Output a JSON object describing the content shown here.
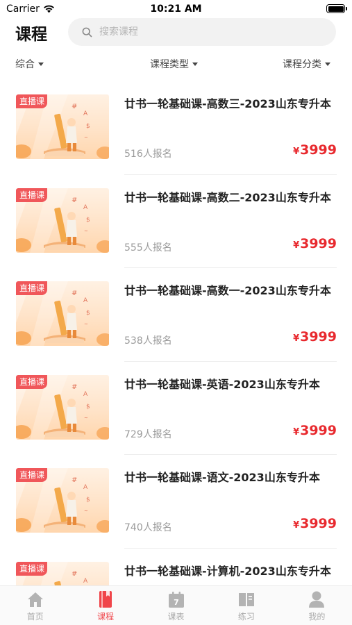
{
  "status_bar": {
    "carrier": "Carrier",
    "time": "10:21 AM"
  },
  "header": {
    "title": "课程",
    "search_placeholder": "搜索课程"
  },
  "filters": [
    {
      "label": "综合"
    },
    {
      "label": "课程类型"
    },
    {
      "label": "课程分类"
    }
  ],
  "courses": [
    {
      "badge": "直播课",
      "title": "廿书一轮基础课-高数三-2023山东专升本",
      "enrolled": "516人报名",
      "currency": "¥",
      "price": "3999"
    },
    {
      "badge": "直播课",
      "title": "廿书一轮基础课-高数二-2023山东专升本",
      "enrolled": "555人报名",
      "currency": "¥",
      "price": "3999"
    },
    {
      "badge": "直播课",
      "title": "廿书一轮基础课-高数一-2023山东专升本",
      "enrolled": "538人报名",
      "currency": "¥",
      "price": "3999"
    },
    {
      "badge": "直播课",
      "title": "廿书一轮基础课-英语-2023山东专升本",
      "enrolled": "729人报名",
      "currency": "¥",
      "price": "3999"
    },
    {
      "badge": "直播课",
      "title": "廿书一轮基础课-语文-2023山东专升本",
      "enrolled": "740人报名",
      "currency": "¥",
      "price": "3999"
    },
    {
      "badge": "直播课",
      "title": "廿书一轮基础课-计算机-2023山东专升本",
      "enrolled": "",
      "currency": "",
      "price": ""
    }
  ],
  "tabs": [
    {
      "label": "首页",
      "icon": "home-icon"
    },
    {
      "label": "课程",
      "icon": "book-icon"
    },
    {
      "label": "课表",
      "icon": "calendar-icon",
      "icon_text": "7"
    },
    {
      "label": "练习",
      "icon": "open-book-icon"
    },
    {
      "label": "我的",
      "icon": "user-icon"
    }
  ],
  "active_tab": 1,
  "colors": {
    "accent": "#f0454a",
    "price": "#e8292e",
    "badge": "#f0575a"
  }
}
